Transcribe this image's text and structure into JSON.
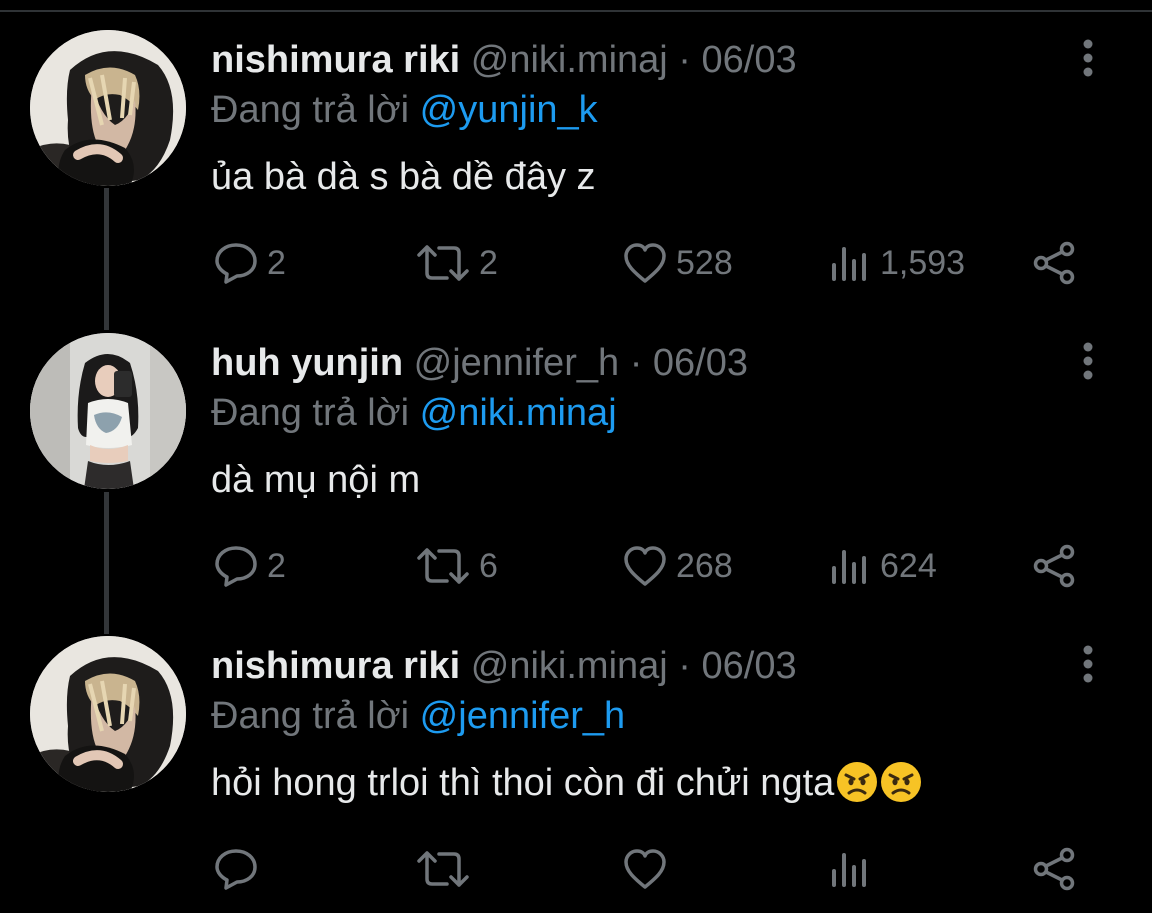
{
  "tweets": [
    {
      "name": "nishimura riki",
      "handle": "@niki.minaj",
      "sep": "·",
      "date": "06/03",
      "reply_label": "Đang trả lời",
      "reply_to": "@yunjin_k",
      "text": "ủa bà dà s bà dề đây z",
      "replies": "2",
      "retweets": "2",
      "likes": "528",
      "views": "1,593"
    },
    {
      "name": "huh yunjin",
      "handle": "@jennifer_h",
      "sep": "·",
      "date": "06/03",
      "reply_label": "Đang trả lời",
      "reply_to": "@niki.minaj",
      "text": "dà mụ nội m",
      "replies": "2",
      "retweets": "6",
      "likes": "268",
      "views": "624"
    },
    {
      "name": "nishimura riki",
      "handle": "@niki.minaj",
      "sep": "·",
      "date": "06/03",
      "reply_label": "Đang trả lời",
      "reply_to": "@jennifer_h",
      "text": "hỏi hong trloi thì thoi còn đi chửi ngta",
      "emoji": [
        "angry-face",
        "angry-face"
      ]
    }
  ],
  "colors": {
    "background": "#000000",
    "text": "#e7e9ea",
    "muted": "#71767b",
    "link": "#1d9bf0",
    "divider": "#2f3336"
  }
}
